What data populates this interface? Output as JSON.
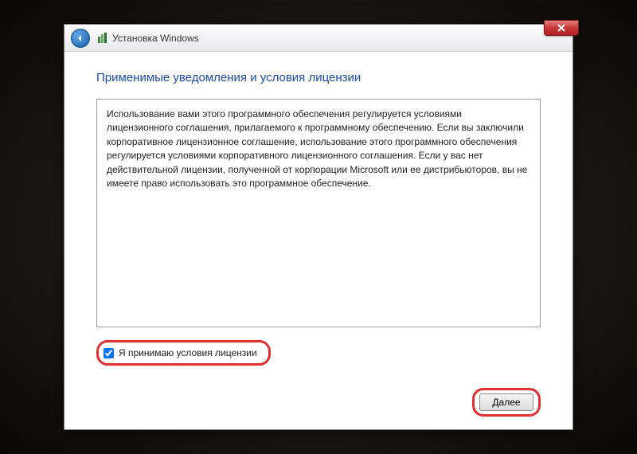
{
  "window": {
    "title": "Установка Windows"
  },
  "content": {
    "heading": "Применимые уведомления и условия лицензии",
    "license_text": "Использование вами этого программного обеспечения регулируется условиями лицензионного соглашения, прилагаемого к программному обеспечению. Если вы заключили корпоративное лицензионное соглашение, использование этого программного обеспечения регулируется условиями корпоративного лицензионного соглашения. Если у вас нет действительной лицензии, полученной от корпорации Microsoft или ее дистрибьюторов, вы не имеете право использовать это программное обеспечение."
  },
  "checkbox": {
    "label": "Я принимаю условия лицензии",
    "checked": true
  },
  "footer": {
    "next_label": "Далее"
  }
}
